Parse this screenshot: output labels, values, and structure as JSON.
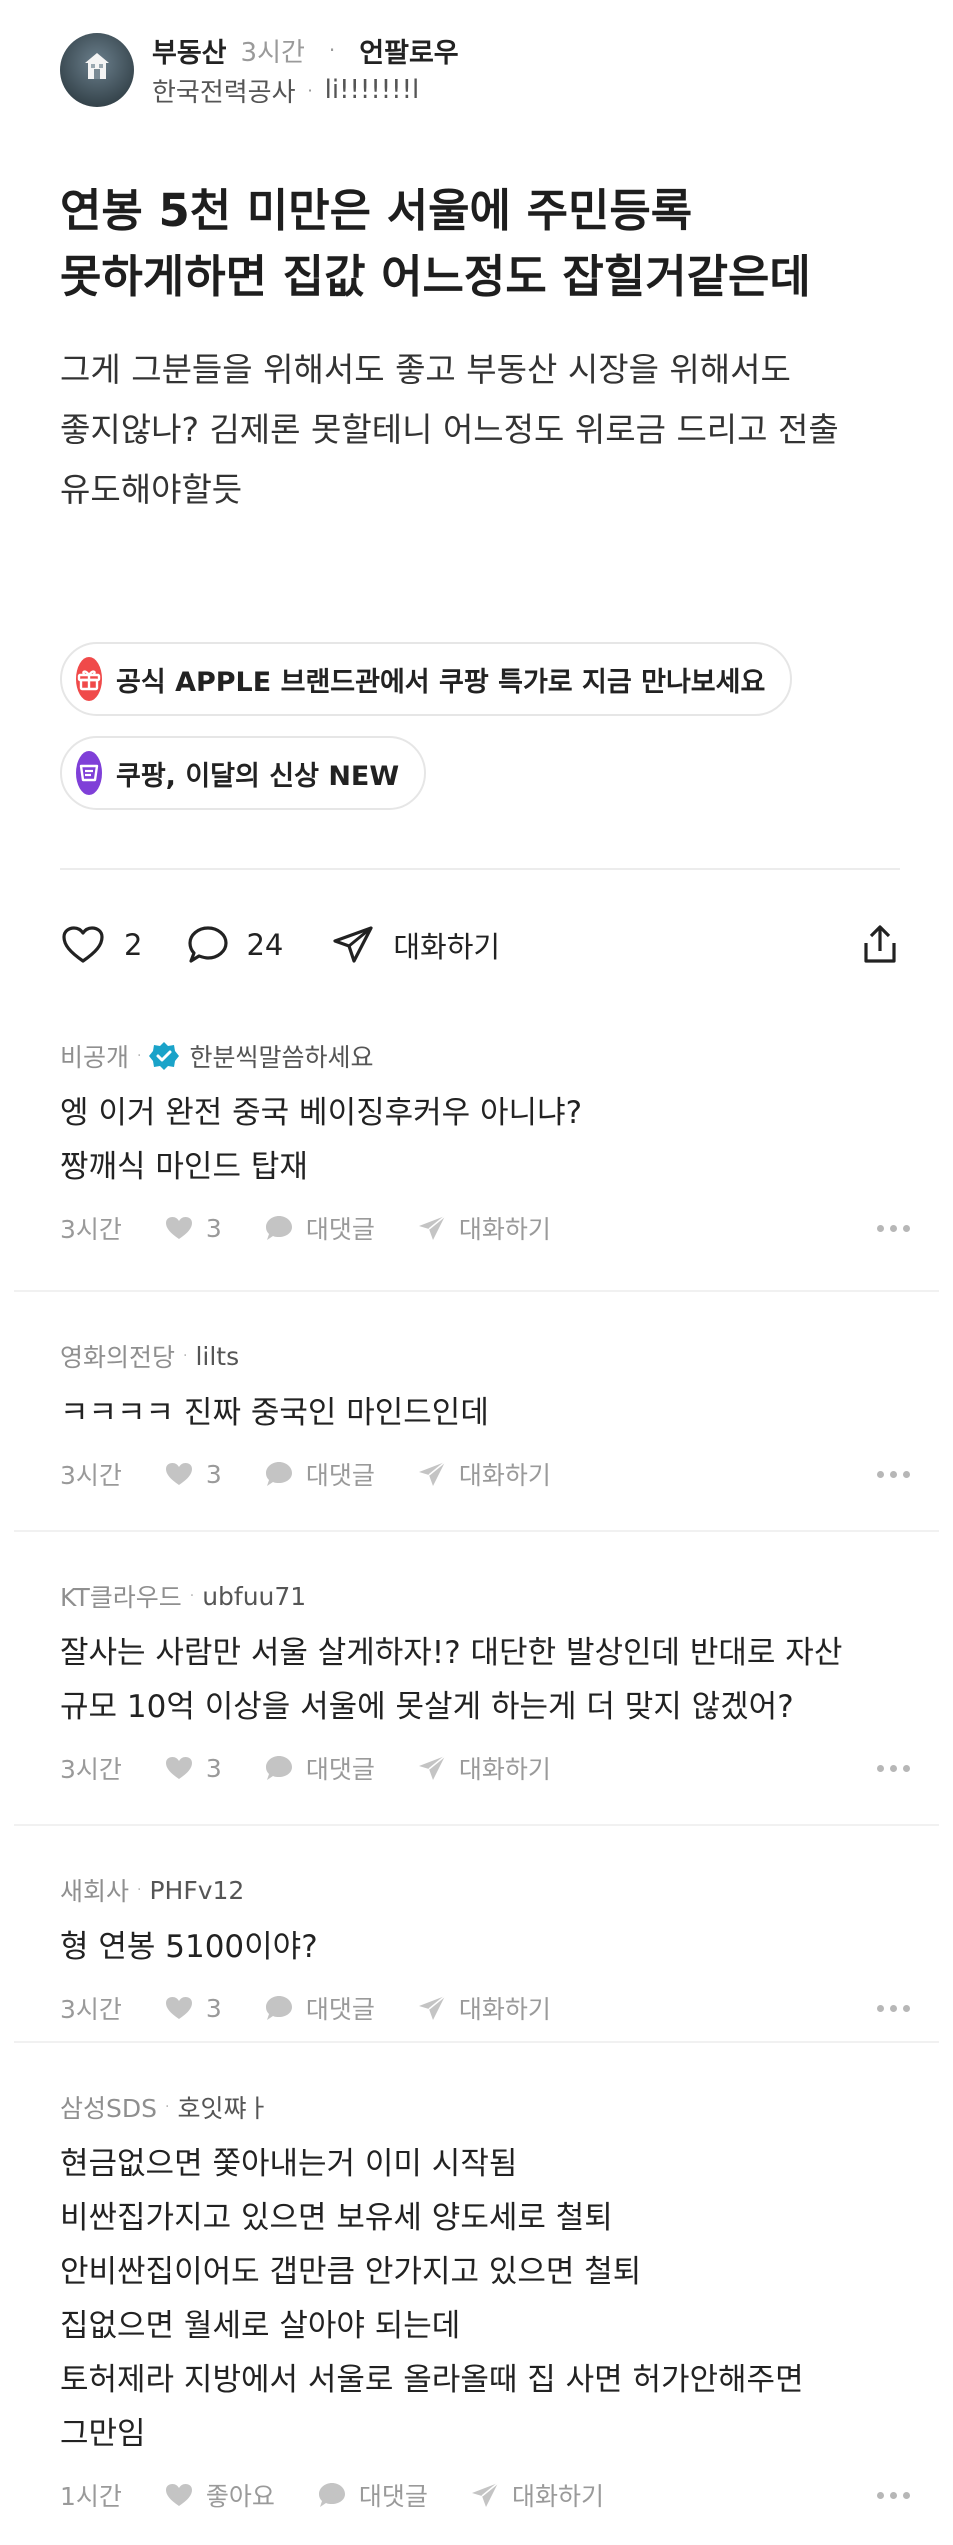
{
  "post": {
    "author": "부동산",
    "time": "3시간",
    "dot": "·",
    "follow_label": "언팔로우",
    "company": "한국전력공사",
    "company_sep": "·",
    "nickname": "li!!!!!!!l",
    "title": "연봉 5천 미만은 서울에 주민등록\n못하게하면 집값 어느정도 잡힐거같은데",
    "body": "그게 그분들을 위해서도 좋고 부동산 시장을 위해서도\n좋지않나? 김제론 못할테니 어느정도 위로금 드리고 전출\n유도해야할듯"
  },
  "ads": [
    {
      "label": "공식 APPLE 브랜드관에서 쿠팡 특가로 지금 만나보세요",
      "icon": "gift-icon",
      "color": "#f04a4a"
    },
    {
      "label": "쿠팡, 이달의 신상 NEW",
      "icon": "tag-icon",
      "color": "#7f3fd8"
    }
  ],
  "actions": {
    "likes": "2",
    "comments": "24",
    "dm_label": "대화하기"
  },
  "comments": [
    {
      "company": "비공개",
      "sep": "·",
      "user": "한분씩말씀하세요",
      "verified": true,
      "text": "엥 이거 완전 중국 베이징후커우 아니냐?\n짱깨식 마인드 탑재",
      "time": "3시간",
      "likes": "3",
      "reply_label": "대댓글",
      "dm_label": "대화하기"
    },
    {
      "company": "영화의전당",
      "sep": "·",
      "user": "lilts",
      "verified": false,
      "text": "ㅋㅋㅋㅋ 진짜 중국인 마인드인데",
      "time": "3시간",
      "likes": "3",
      "reply_label": "대댓글",
      "dm_label": "대화하기"
    },
    {
      "company": "KT클라우드",
      "sep": "·",
      "user": "ubfuu71",
      "verified": false,
      "text": "잘사는 사람만 서울 살게하자!? 대단한 발상인데 반대로 자산\n규모 10억 이상을 서울에 못살게 하는게 더 맞지 않겠어?",
      "time": "3시간",
      "likes": "3",
      "reply_label": "대댓글",
      "dm_label": "대화하기"
    },
    {
      "company": "새회사",
      "sep": "·",
      "user": "PHFv12",
      "verified": false,
      "text": "형 연봉 5100이야?",
      "time": "3시간",
      "likes": "3",
      "reply_label": "대댓글",
      "dm_label": "대화하기"
    },
    {
      "company": "삼성SDS",
      "sep": "·",
      "user": "호잇쨔ㅏ",
      "verified": false,
      "text": "현금없으면  쫓아내는거 이미 시작됨\n비싼집가지고 있으면 보유세 양도세로 철퇴\n안비싼집이어도 갭만큼 안가지고 있으면 철퇴\n집없으면 월세로 살아야 되는데\n토허제라 지방에서 서울로 올라올때 집 사면 허가안해주면\n그만임",
      "time": "1시간",
      "likes": "좋아요",
      "reply_label": "대댓글",
      "dm_label": "대화하기"
    }
  ]
}
